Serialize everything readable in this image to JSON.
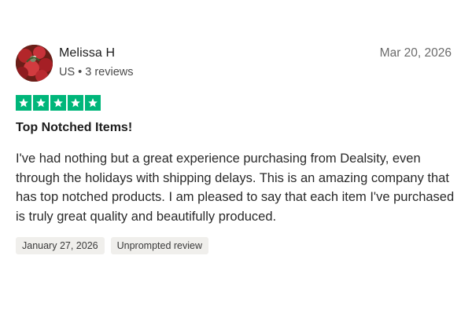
{
  "reviewer": {
    "name": "Melissa H",
    "country": "US",
    "separator": "•",
    "review_count": "3 reviews",
    "avatar_icon": "avatar-photo-icon"
  },
  "review": {
    "date": "Mar 20, 2026",
    "rating": 5,
    "max_rating": 5,
    "star_color": "#00b67a",
    "star_icon": "star-icon",
    "title": "Top Notched Items!",
    "body": "I've had nothing but a great experience purchasing from Dealsity, even through the holidays with shipping delays. This is an amazing company that has top notched products. I am pleased to say that each item I've purchased is truly great quality and beautifully produced."
  },
  "tags": {
    "experience_date": "January 27, 2026",
    "review_type": "Unprompted review"
  }
}
